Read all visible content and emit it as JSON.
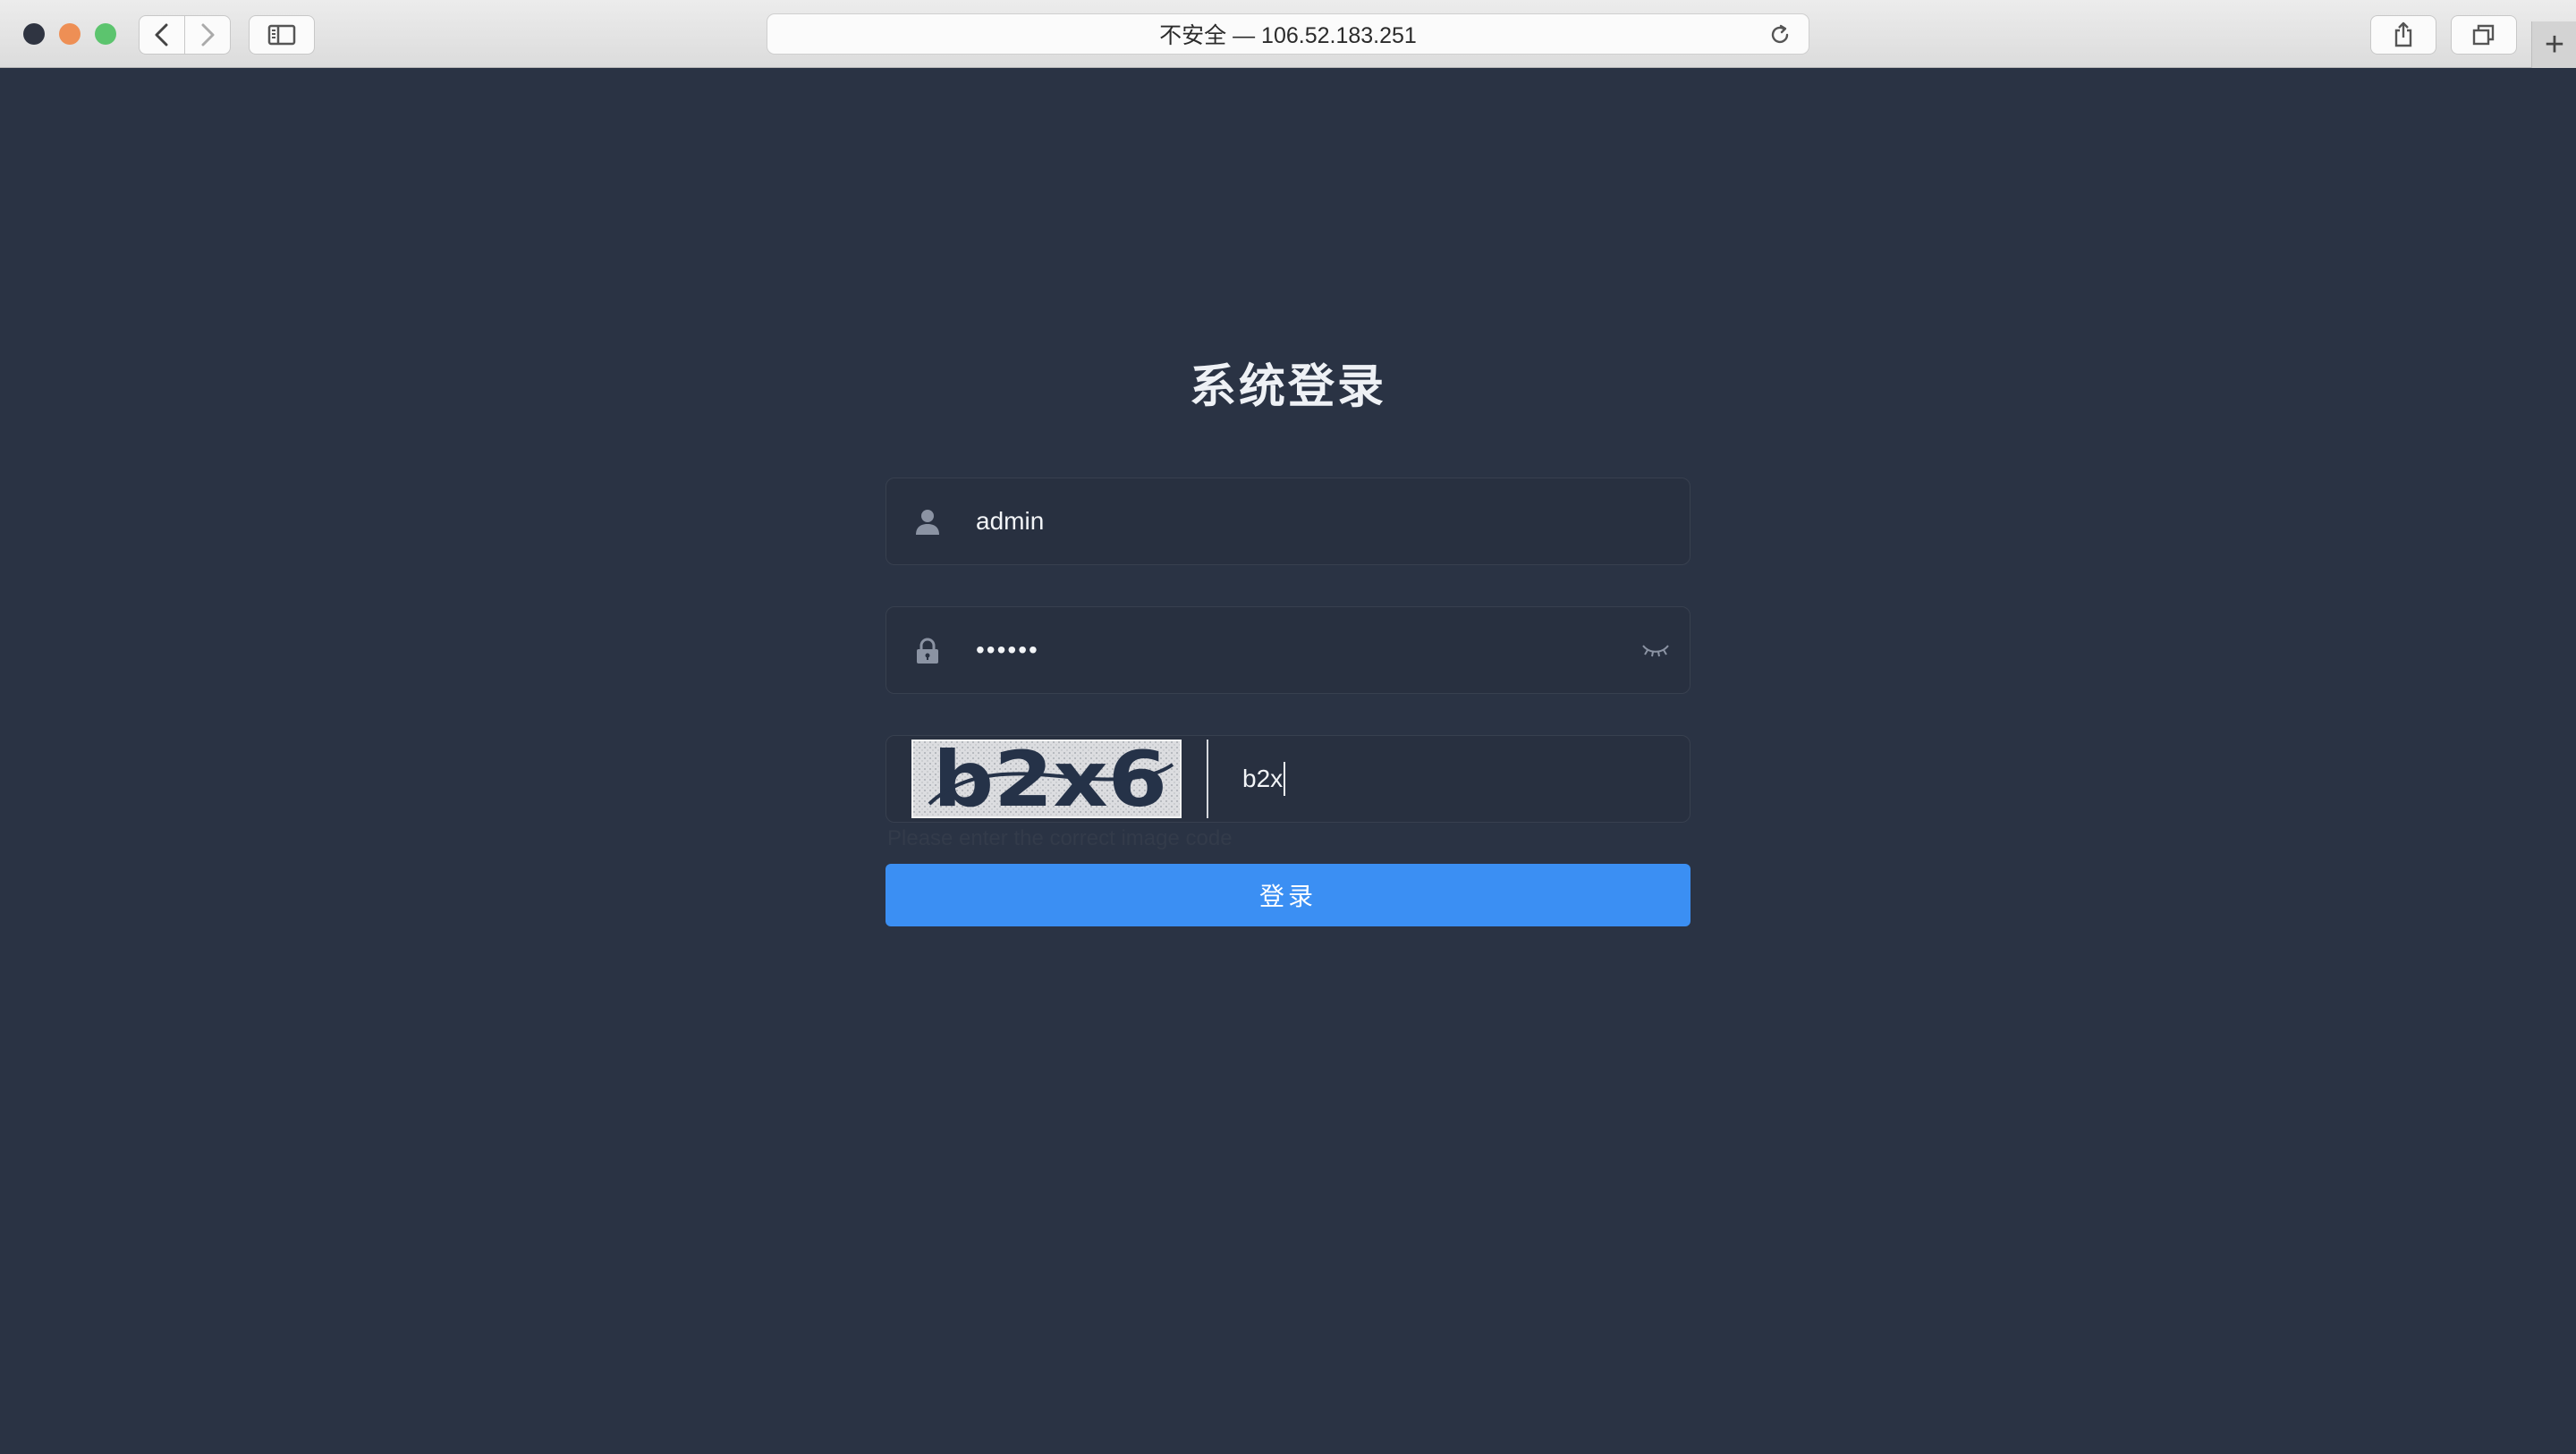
{
  "browser": {
    "address": "不安全 — 106.52.183.251",
    "new_tab_symbol": "+"
  },
  "login": {
    "title": "系统登录",
    "username": "admin",
    "password_mask": "••••••",
    "captcha_value": "b2x",
    "captcha_image_text": "b2x6",
    "hint": "Please enter the correct image code",
    "submit_label": "登录"
  },
  "colors": {
    "page_background": "#2a3344",
    "field_background": "#283040",
    "button": "#3b8ff3"
  },
  "icons": {
    "username": "user-icon",
    "password": "lock-icon",
    "toggle": "eye-closed-icon"
  }
}
